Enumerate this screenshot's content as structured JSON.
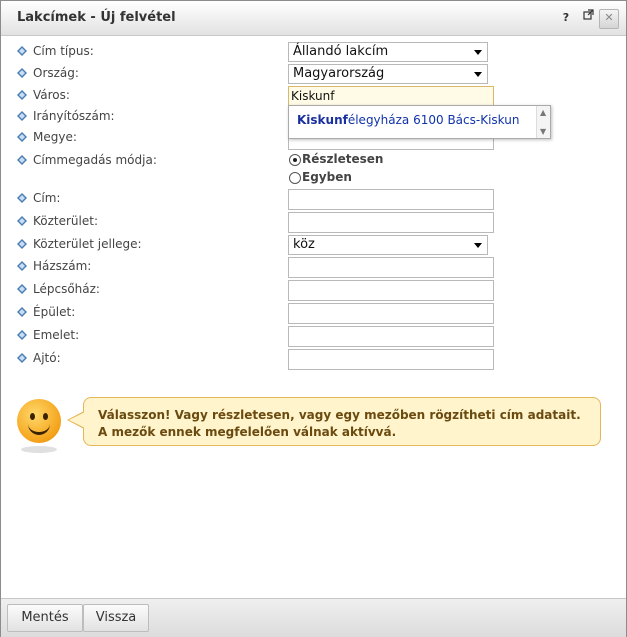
{
  "window": {
    "title": "Lakcímek - Új felvétel",
    "help_label": "?",
    "popout_icon": "popout-icon",
    "close_icon": "close-icon"
  },
  "fields": {
    "cim_tipus": {
      "label": "Cím típus:",
      "value": "Állandó lakcím"
    },
    "orszag": {
      "label": "Ország:",
      "value": "Magyarország"
    },
    "varos": {
      "label": "Város:",
      "value": "Kiskunf"
    },
    "iranyitoszam": {
      "label": "Irányítószám:",
      "value": ""
    },
    "megye": {
      "label": "Megye:",
      "value": ""
    },
    "cimmegadas": {
      "label": "Címmegadás módja:",
      "options": [
        "Részletesen",
        "Egyben"
      ],
      "selected": "Részletesen"
    },
    "cim": {
      "label": "Cím:",
      "value": ""
    },
    "kozterulet": {
      "label": "Közterület:",
      "value": ""
    },
    "kozterulet_jellege": {
      "label": "Közterület jellege:",
      "value": "köz"
    },
    "hazszam": {
      "label": "Házszám:",
      "value": ""
    },
    "lepcsohaz": {
      "label": "Lépcsőház:",
      "value": ""
    },
    "epulet": {
      "label": "Épület:",
      "value": ""
    },
    "emelet": {
      "label": "Emelet:",
      "value": ""
    },
    "ajto": {
      "label": "Ajtó:",
      "value": ""
    }
  },
  "autocomplete": {
    "match": "Kiskunf",
    "rest": "élegyháza 6100 Bács-Kiskun"
  },
  "hint": {
    "icon": "smiley-icon",
    "message": "Válasszon! Vagy részletesen, vagy egy mezőben rögzítheti cím adatait. A mezők ennek megfelelően válnak aktívvá."
  },
  "footer": {
    "save_label": "Mentés",
    "back_label": "Vissza"
  },
  "colors": {
    "bullet": "#4a7fb5",
    "autocomplete_text": "#1133aa",
    "hint_bg": "#fff4cc",
    "hint_border": "#e5b65a"
  }
}
